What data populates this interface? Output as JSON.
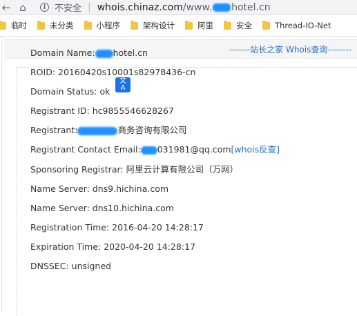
{
  "browser": {
    "insecure_label": "不安全",
    "url_host": "whois.chinaz.com",
    "url_path_prefix": "/www.",
    "url_path_suffix": "hotel.cn"
  },
  "bookmarks": [
    {
      "label": "临时"
    },
    {
      "label": "未分类"
    },
    {
      "label": "小程序"
    },
    {
      "label": "架构设计"
    },
    {
      "label": "阿里"
    },
    {
      "label": "安全"
    },
    {
      "label": "Thread-IO-Net"
    }
  ],
  "page": {
    "header_title": "-------站长之家 Whois查询--------"
  },
  "whois": {
    "domain_name_label": "Domain Name:",
    "domain_name_value": "hotel.cn",
    "roid": "ROID: 20160420s10001s82978436-cn",
    "status": "Domain Status: ok",
    "registrant_id": "Registrant ID: hc9855546628267",
    "registrant_label": "Registrant:",
    "registrant_value": "商务咨询有限公司",
    "email_label": "Registrant Contact Email:",
    "email_value": "031981@qq.com",
    "email_link": "[whois反查]",
    "sponsoring_registrar": "Sponsoring Registrar: 阿里云计算有限公司（万网）",
    "name_server_1": "Name Server: dns9.hichina.com",
    "name_server_2": "Name Server: dns10.hichina.com",
    "registration_time": "Registration Time: 2016-04-20 14:28:17",
    "expiration_time": "Expiration Time: 2020-04-20 14:28:17",
    "dnssec": "DNSSEC: unsigned"
  },
  "translate_popup": {
    "glyph_top": "文",
    "glyph_bottom": "A"
  }
}
